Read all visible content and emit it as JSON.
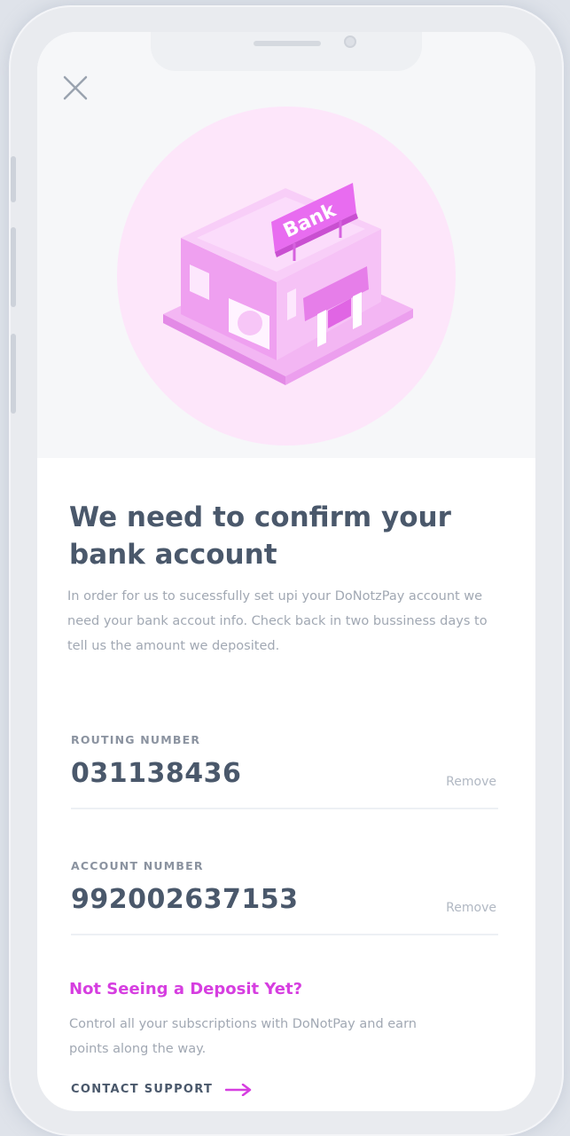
{
  "title": "We need to confirm your bank account",
  "description": "In order for us to sucessfully set upi your DoNotzPay account we need your bank accout info. Check back in two bussiness days to tell us the amount we deposited.",
  "illustration": {
    "sign_text": "Bank",
    "accent_color": "#e86cf0"
  },
  "routing": {
    "label": "ROUTING NUMBER",
    "value": "031138436",
    "remove_label": "Remove"
  },
  "account": {
    "label": "ACCOUNT NUMBER",
    "value": "992002637153",
    "remove_label": "Remove"
  },
  "deposit_help": {
    "heading": "Not Seeing a Deposit Yet?",
    "text": "Control all your subscriptions with DoNotPay and earn points along the way.",
    "link_label": "CONTACT SUPPORT"
  },
  "icons": {
    "close": "close-icon",
    "arrow": "arrow-right-icon"
  },
  "colors": {
    "heading": "#4a586b",
    "accent": "#d63ee0",
    "muted": "#a1a8b3"
  }
}
